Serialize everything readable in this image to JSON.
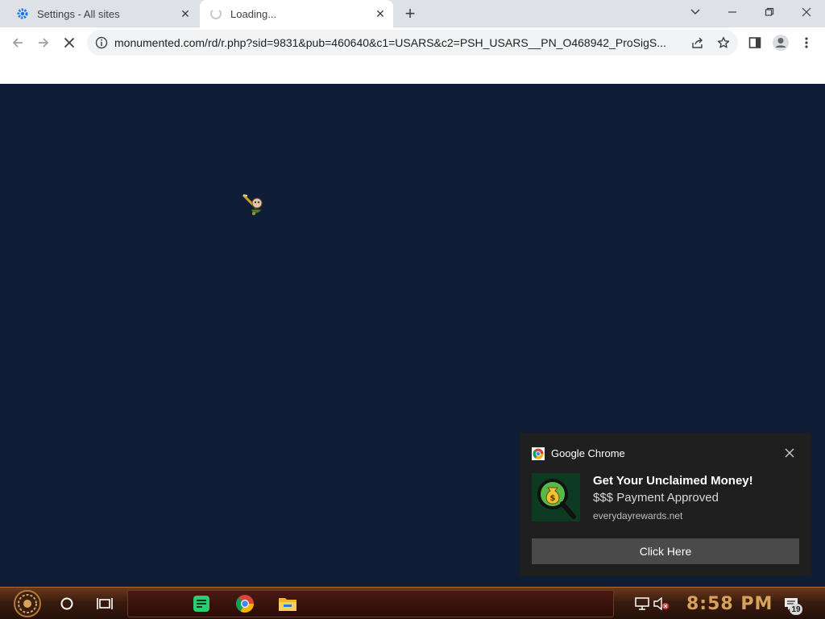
{
  "browser": {
    "tabs": [
      {
        "title": "Settings - All sites",
        "favicon": "gear-icon"
      },
      {
        "title": "Loading...",
        "favicon": "spinner-icon"
      }
    ],
    "url": "monumented.com/rd/r.php?sid=9831&pub=460640&c1=USARS&c2=PSH_USARS__PN_O468942_ProSigS..."
  },
  "notification": {
    "app_name": "Google Chrome",
    "headline": "Get Your Unclaimed Money!",
    "body": "$$$ Payment Approved",
    "source": "everydayrewards.net",
    "action_label": "Click Here"
  },
  "taskbar": {
    "clock": "8:58 PM",
    "notification_count": "19"
  },
  "colors": {
    "page_background": "#0f1e36",
    "tab_strip": "#dee1e6",
    "notification_background": "#1f1f1f",
    "clock": "#d9a25a"
  }
}
